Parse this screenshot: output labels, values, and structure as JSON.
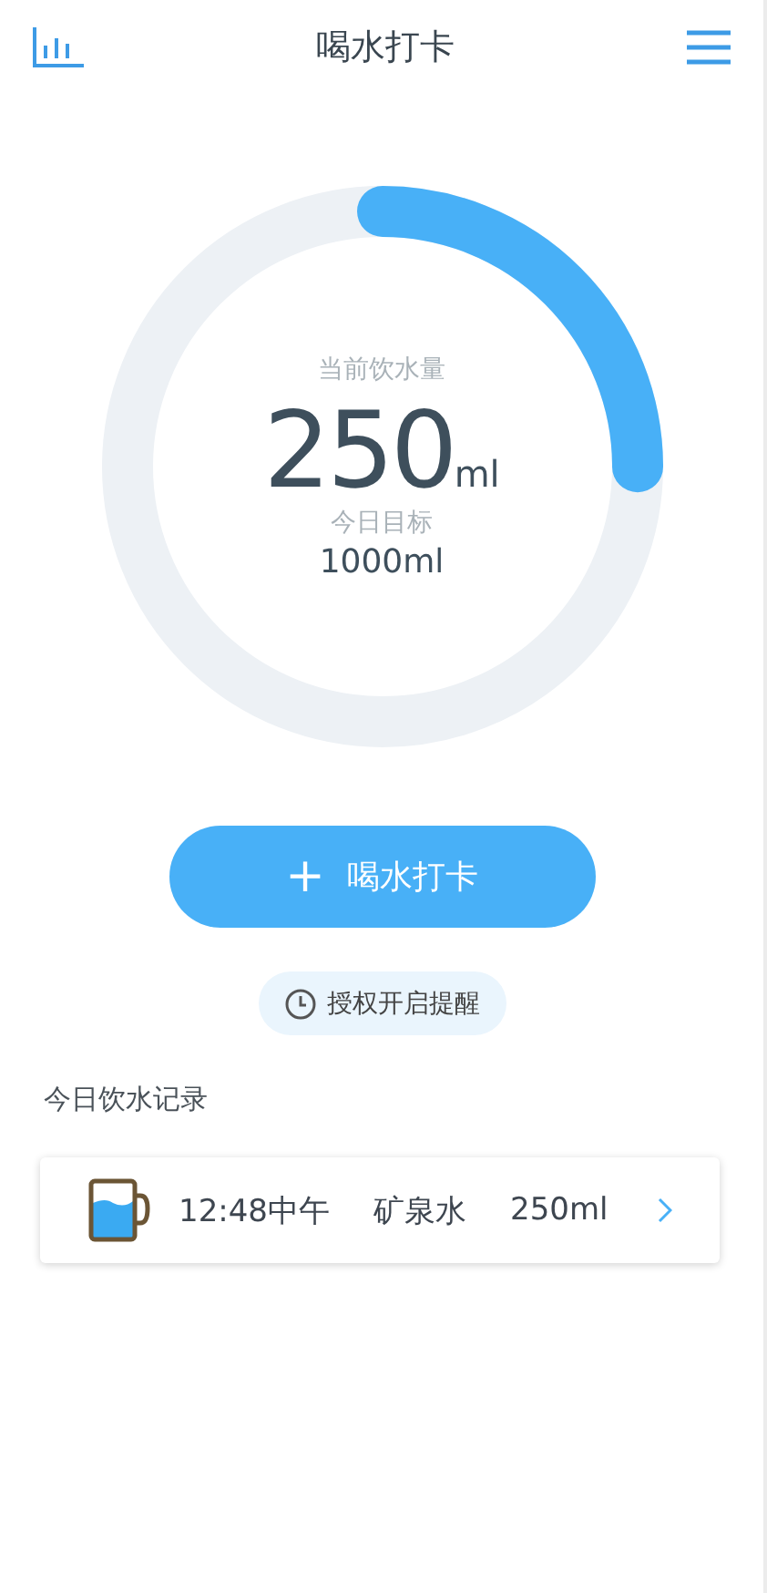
{
  "header": {
    "title": "喝水打卡"
  },
  "progress": {
    "label": "当前饮水量",
    "amount": "250",
    "unit": "ml",
    "goal_label": "今日目标",
    "goal": "1000ml"
  },
  "checkin_button": {
    "icon": "+",
    "label": "喝水打卡"
  },
  "reminder": {
    "label": "授权开启提醒"
  },
  "records": {
    "title": "今日饮水记录",
    "items": [
      {
        "time": "12:48中午",
        "drink": "矿泉水",
        "amount": "250ml"
      }
    ]
  }
}
